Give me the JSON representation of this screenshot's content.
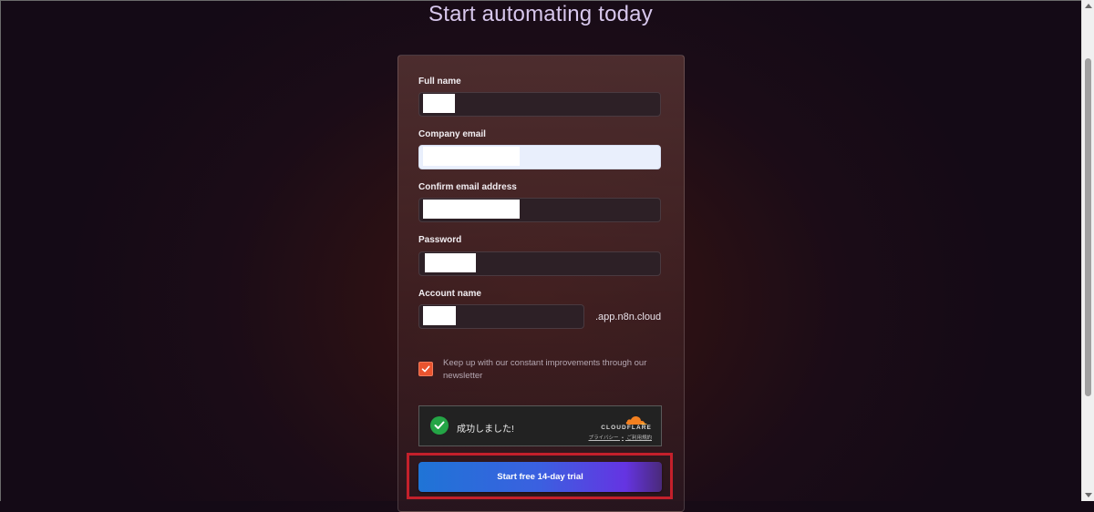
{
  "page": {
    "title": "Start automating today"
  },
  "form": {
    "full_name": {
      "label": "Full name",
      "value": ""
    },
    "company_email": {
      "label": "Company email",
      "value": ""
    },
    "confirm_email": {
      "label": "Confirm email address",
      "value": ""
    },
    "password": {
      "label": "Password",
      "value": ""
    },
    "account_name": {
      "label": "Account name",
      "value": "",
      "suffix": ".app.n8n.cloud"
    },
    "newsletter": {
      "checked": true,
      "label": "Keep up with our constant improvements through our newsletter"
    },
    "captcha": {
      "status_text": "成功しました!",
      "provider": "CLOUDFLARE",
      "privacy_link": "プライバシー",
      "separator": "•",
      "terms_link": "ご利用規約"
    },
    "submit_label": "Start free 14-day trial"
  },
  "colors": {
    "accent_orange": "#e9542f",
    "button_gradient_start": "#1f74d6",
    "button_gradient_end": "#6534e2",
    "highlight_red": "#c4202b",
    "captcha_success": "#24a546"
  }
}
